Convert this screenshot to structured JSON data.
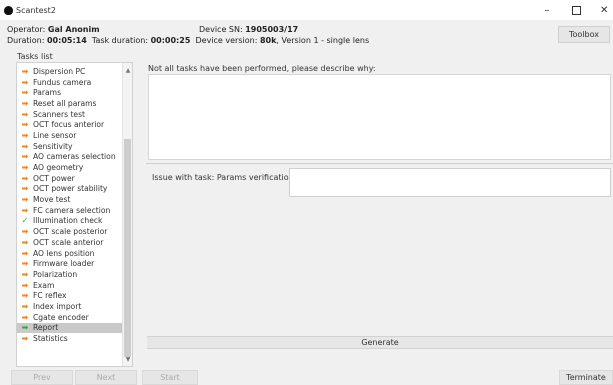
{
  "window": {
    "title": "Scantest2",
    "minimize": "–",
    "close": "✕"
  },
  "header": {
    "operator_label": "Operator: ",
    "operator_value": "Gal Anonim",
    "device_sn_label": "Device SN: ",
    "device_sn_value": "1905003/17",
    "duration_label": "Duration: ",
    "duration_value": "00:05:14",
    "task_duration_label": "Task duration: ",
    "task_duration_value": "00:00:25",
    "device_version_label": "Device version: ",
    "device_version_value": "80k",
    "device_version_suffix": ", Version 1 - single lens",
    "toolbox_label": "Toolbox"
  },
  "tasks": {
    "label": "Tasks list",
    "items": [
      {
        "label": "Dispersion PC",
        "icon": "arrow-right-icon"
      },
      {
        "label": "Fundus camera",
        "icon": "arrow-right-icon"
      },
      {
        "label": "Params",
        "icon": "arrow-right-icon"
      },
      {
        "label": "Reset all params",
        "icon": "arrow-right-icon"
      },
      {
        "label": "Scanners test",
        "icon": "arrow-right-icon"
      },
      {
        "label": "OCT focus anterior",
        "icon": "arrow-right-icon"
      },
      {
        "label": "Line sensor",
        "icon": "arrow-right-icon"
      },
      {
        "label": "Sensitivity",
        "icon": "arrow-right-icon"
      },
      {
        "label": "AO cameras selection",
        "icon": "arrow-right-icon"
      },
      {
        "label": "AO geometry",
        "icon": "arrow-right-icon"
      },
      {
        "label": "OCT power",
        "icon": "arrow-right-icon"
      },
      {
        "label": "OCT power stability",
        "icon": "arrow-right-icon"
      },
      {
        "label": "Move test",
        "icon": "arrow-right-icon"
      },
      {
        "label": "FC camera selection",
        "icon": "arrow-right-icon"
      },
      {
        "label": "Illumination check",
        "icon": "check-icon"
      },
      {
        "label": "OCT scale posterior",
        "icon": "arrow-right-icon"
      },
      {
        "label": "OCT scale anterior",
        "icon": "arrow-right-icon"
      },
      {
        "label": "AO lens position",
        "icon": "arrow-right-icon"
      },
      {
        "label": "Firmware loader",
        "icon": "arrow-right-icon"
      },
      {
        "label": "Polarization",
        "icon": "arrow-right-icon"
      },
      {
        "label": "Exam",
        "icon": "arrow-right-icon"
      },
      {
        "label": "FC reflex",
        "icon": "arrow-right-icon"
      },
      {
        "label": "Index import",
        "icon": "arrow-right-icon"
      },
      {
        "label": "Cgate encoder",
        "icon": "arrow-right-icon"
      },
      {
        "label": "Report",
        "icon": "play-icon"
      },
      {
        "label": "Statistics",
        "icon": "arrow-right-icon"
      }
    ],
    "selected_index": 24
  },
  "main": {
    "prompt": "Not all tasks have been performed, please describe why:",
    "reason_value": "",
    "issue_label": "Issue with task: Params verification",
    "issue_value": "",
    "generate_label": "Generate"
  },
  "footer": {
    "prev_label": "Prev",
    "next_label": "Next",
    "start_label": "Start",
    "terminate_label": "Terminate"
  },
  "colors": {
    "arrow": "#e9862a",
    "check": "#3aa73a",
    "selected_row": "#c9c9c9",
    "window_bg": "#f0f0f0"
  }
}
